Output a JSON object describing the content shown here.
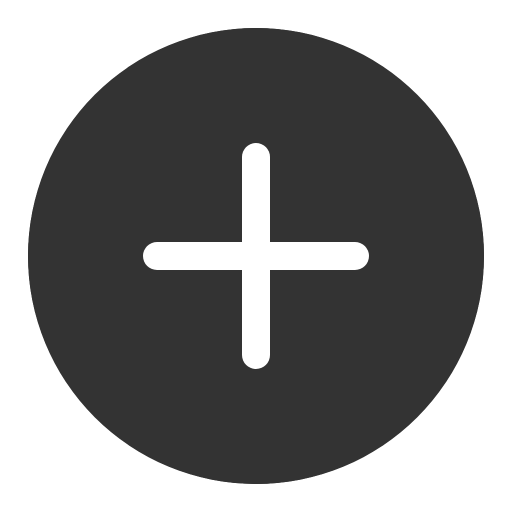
{
  "add_button": {
    "icon": "plus-icon",
    "colors": {
      "background": "#333333",
      "glyph": "#ffffff"
    }
  }
}
